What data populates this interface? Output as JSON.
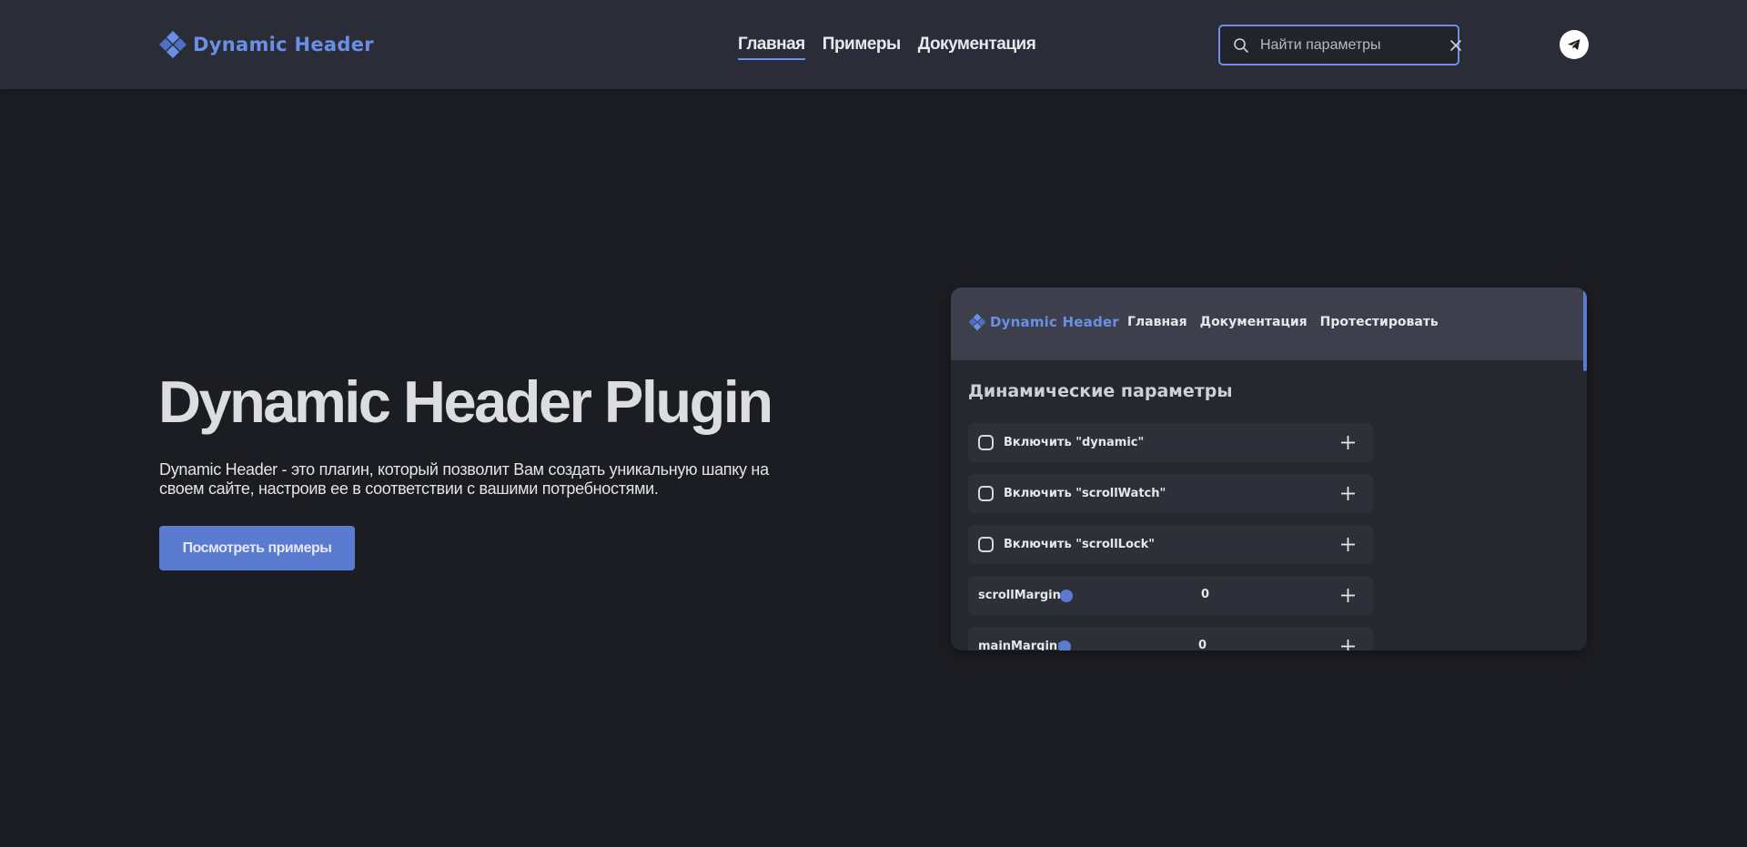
{
  "header": {
    "logo_text": "Dynamic Header",
    "nav": [
      {
        "label": "Главная",
        "active": true
      },
      {
        "label": "Примеры",
        "active": false
      },
      {
        "label": "Документация",
        "active": false
      }
    ],
    "search": {
      "placeholder": "Найти параметры",
      "value": ""
    },
    "social_icon": "telegram-icon"
  },
  "hero": {
    "title": "Dynamic Header Plugin",
    "description": "Dynamic Header - это плагин, который позволит Вам создать уникальную шапку на своем сайте, настроив ее в соответствии с вашими потребностями.",
    "button_label": "Посмотреть примеры"
  },
  "preview": {
    "logo_text": "Dynamic Header",
    "nav": [
      "Главная",
      "Документация",
      "Протестировать"
    ],
    "section_title": "Динамические параметры",
    "options": [
      {
        "type": "checkbox",
        "label": "Включить \"dynamic\"",
        "checked": false
      },
      {
        "type": "checkbox",
        "label": "Включить \"scrollWatch\"",
        "checked": false
      },
      {
        "type": "checkbox",
        "label": "Включить \"scrollLock\"",
        "checked": false
      },
      {
        "type": "slider",
        "label": "scrollMargin:",
        "value": "0"
      },
      {
        "type": "slider",
        "label": "mainMargin:",
        "value": "0"
      }
    ]
  },
  "colors": {
    "accent": "#6c8fe6",
    "button": "#5b7bd0",
    "header_bg": "#2a2d37",
    "page_bg": "#1c1d22"
  }
}
